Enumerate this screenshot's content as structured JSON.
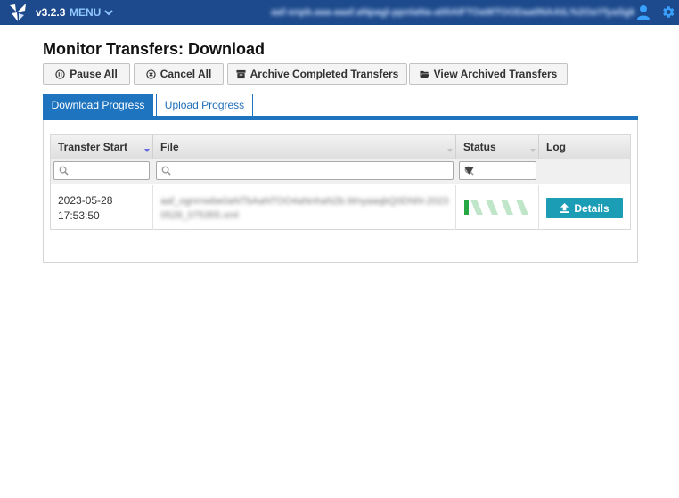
{
  "topbar": {
    "version": "v3.2.3",
    "menu_label": "MENU",
    "user_id": "aaf-snpb.aaa-aaaf.aNpagl-ppnlaNa-a00AlFTOaWTOODaa0NAAtL%2OaYfyaSgk3DIIA1",
    "brand_color": "#1d4a8c"
  },
  "page": {
    "title": "Monitor Transfers: Download"
  },
  "toolbar": {
    "pause_all": "Pause All",
    "cancel_all": "Cancel All",
    "archive_completed": "Archive Completed Transfers",
    "view_archived": "View Archived Transfers"
  },
  "tabs": {
    "download": "Download Progress",
    "upload": "Upload Progress",
    "active": "download"
  },
  "grid": {
    "columns": {
      "transfer_start": "Transfer Start",
      "file": "File",
      "status": "Status",
      "log": "Log"
    },
    "rows": [
      {
        "date": "2023-05-28",
        "time": "17:53:50",
        "file": "aaf_ognrnwbe0aNTbAaNTOO4aNnhaN2b.WnyaaqbQ0DNhl-20230528_075355.xml",
        "status_icon": "striped-progress-bar",
        "details_label": "Details"
      }
    ]
  }
}
